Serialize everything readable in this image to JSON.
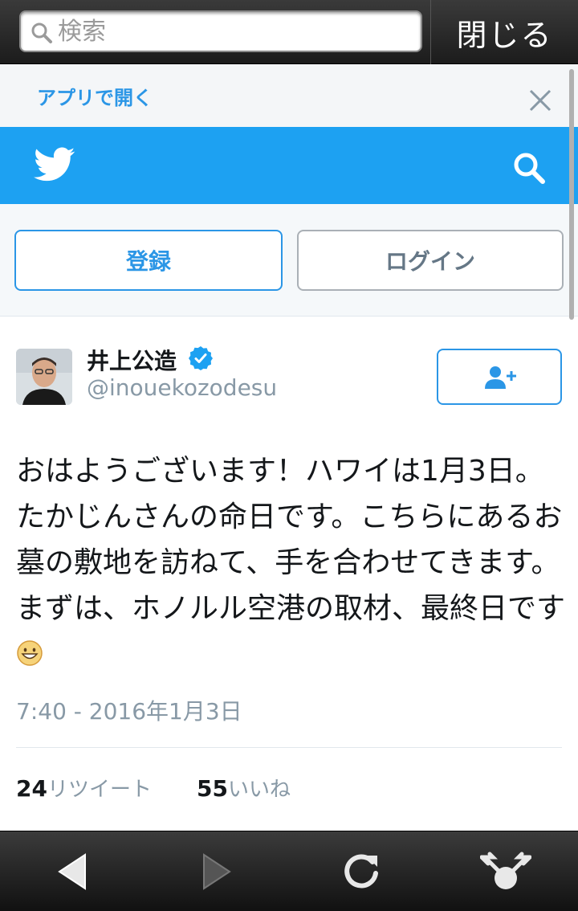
{
  "browser": {
    "search_placeholder": "検索",
    "close_label": "閉じる"
  },
  "banner": {
    "open_in_app": "アプリで開く"
  },
  "auth": {
    "signup_label": "登録",
    "login_label": "ログイン"
  },
  "tweet": {
    "user_name": "井上公造",
    "user_handle": "@inouekozodesu",
    "verified": true,
    "text": "おはようございます！ハワイは1月3日。たかじんさんの命日です。こちらにあるお墓の敷地を訪ねて、手を合わせてきます。まずは、ホノルル空港の取材、最終日です",
    "emoji": "grinning-face",
    "timestamp": "7:40 - 2016年1月3日",
    "retweet_count": "24",
    "retweet_label": "リツイート",
    "like_count": "55",
    "like_label": "いいね"
  },
  "colors": {
    "twitter_blue": "#1da1f2",
    "link_blue": "#2b96e6",
    "muted_gray": "#8899a6"
  },
  "icons": {
    "search": "search-icon",
    "close": "close-icon",
    "bird": "twitter-bird-icon",
    "verified": "verified-badge-icon",
    "follow": "follow-user-icon",
    "back": "back-arrow-icon",
    "forward": "forward-arrow-icon",
    "reload": "reload-icon",
    "share": "share-icon"
  }
}
